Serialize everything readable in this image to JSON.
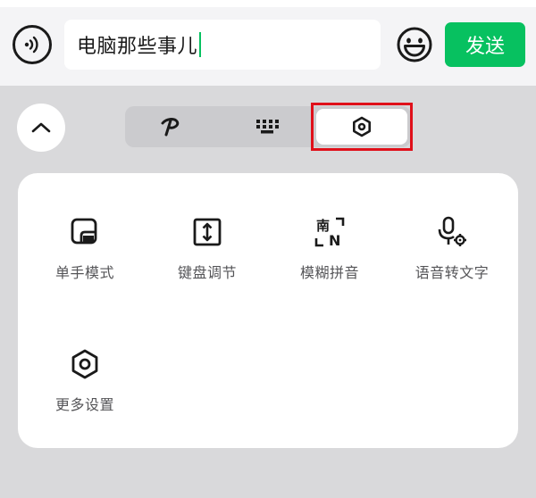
{
  "input": {
    "text": "电脑那些事儿",
    "caret_color": "#07c160"
  },
  "toolbar": {
    "send_label": "发送",
    "voice_icon": "voice-input-icon",
    "emoji_icon": "emoji-smile-icon",
    "send_color": "#07c160"
  },
  "tabs": [
    {
      "name": "handwriting",
      "icon": "handwriting-icon"
    },
    {
      "name": "keyboard",
      "icon": "keyboard-icon"
    },
    {
      "name": "settings",
      "icon": "settings-hexagon-icon",
      "selected": true
    }
  ],
  "highlight_color": "#e0101a",
  "panel": {
    "items": [
      {
        "label": "单手模式",
        "icon": "one-hand-mode-icon"
      },
      {
        "label": "键盘调节",
        "icon": "keyboard-resize-icon"
      },
      {
        "label": "模糊拼音",
        "icon": "fuzzy-pinyin-icon",
        "glyph_top": "南",
        "glyph_bottom": "N"
      },
      {
        "label": "语音转文字",
        "icon": "voice-to-text-icon"
      },
      {
        "label": "更多设置",
        "icon": "more-settings-icon"
      }
    ]
  }
}
